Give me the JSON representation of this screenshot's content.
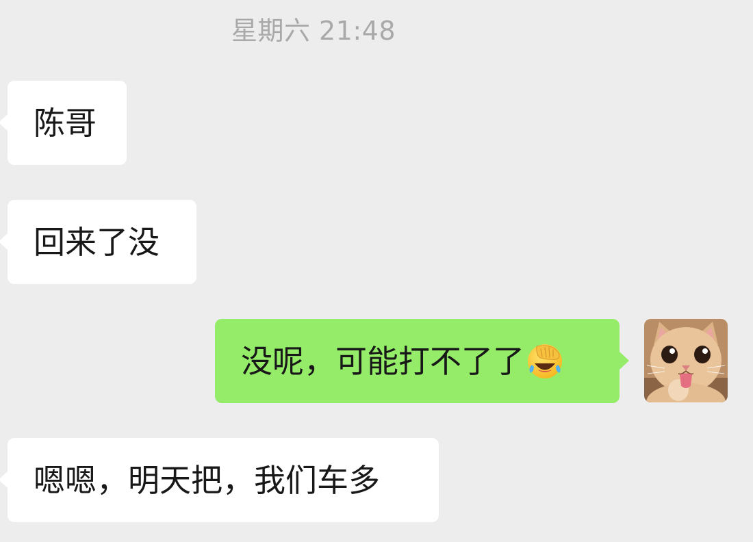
{
  "timestamp": "星期六 21:48",
  "messages": [
    {
      "side": "incoming",
      "text": "陈哥"
    },
    {
      "side": "incoming",
      "text": "回来了没"
    },
    {
      "side": "outgoing",
      "text": "没呢，可能打不了了",
      "emoji": "face-palm-laugh-emoji"
    },
    {
      "side": "incoming",
      "text": "嗯嗯，明天把，我们车多"
    }
  ],
  "colors": {
    "background": "#ededed",
    "incoming_bubble": "#ffffff",
    "outgoing_bubble": "#95ec69",
    "timestamp_text": "#a9a9a9",
    "message_text": "#181818"
  },
  "avatar": {
    "icon": "cat-avatar-icon"
  }
}
